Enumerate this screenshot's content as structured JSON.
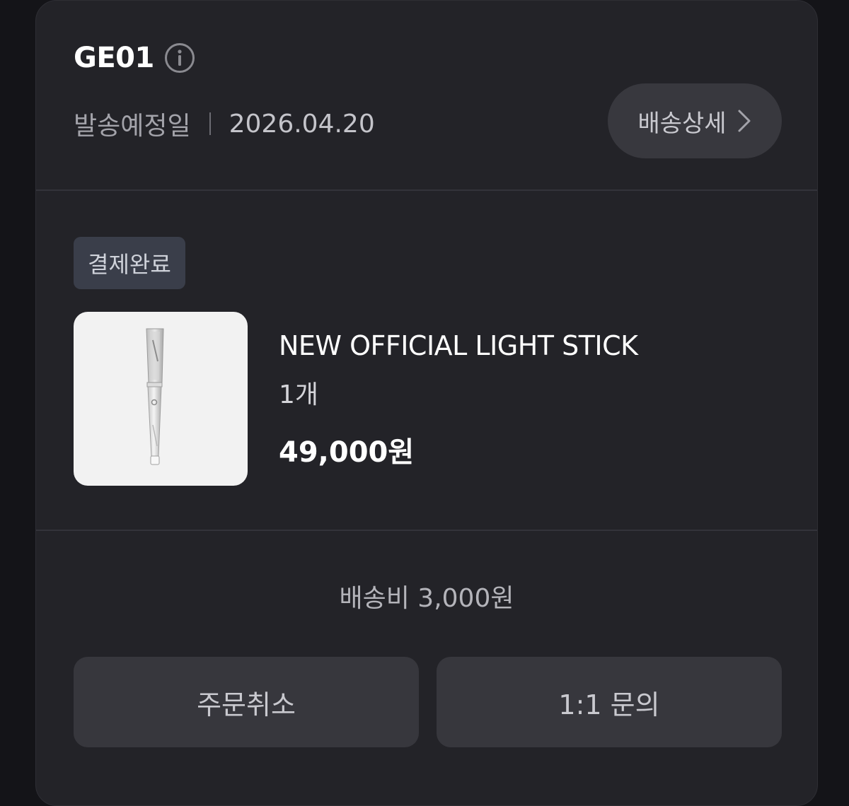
{
  "order": {
    "id": "GE01",
    "ship_label": "발송예정일",
    "ship_date": "2026.04.20",
    "detail_button": "배송상세"
  },
  "item": {
    "status": "결제완료",
    "name": "NEW OFFICIAL LIGHT STICK",
    "quantity": "1개",
    "price": "49,000원",
    "image_alt": "light-stick-product-photo"
  },
  "summary": {
    "shipping_fee": "배송비 3,000원"
  },
  "actions": {
    "cancel_label": "주문취소",
    "inquiry_label": "1:1 문의"
  },
  "icons": {
    "info": "info-circle-icon",
    "chevron": "chevron-right-icon"
  },
  "colors": {
    "background": "#141418",
    "card": "#232328",
    "button": "#37373d",
    "badge": "#3a3e4a"
  }
}
